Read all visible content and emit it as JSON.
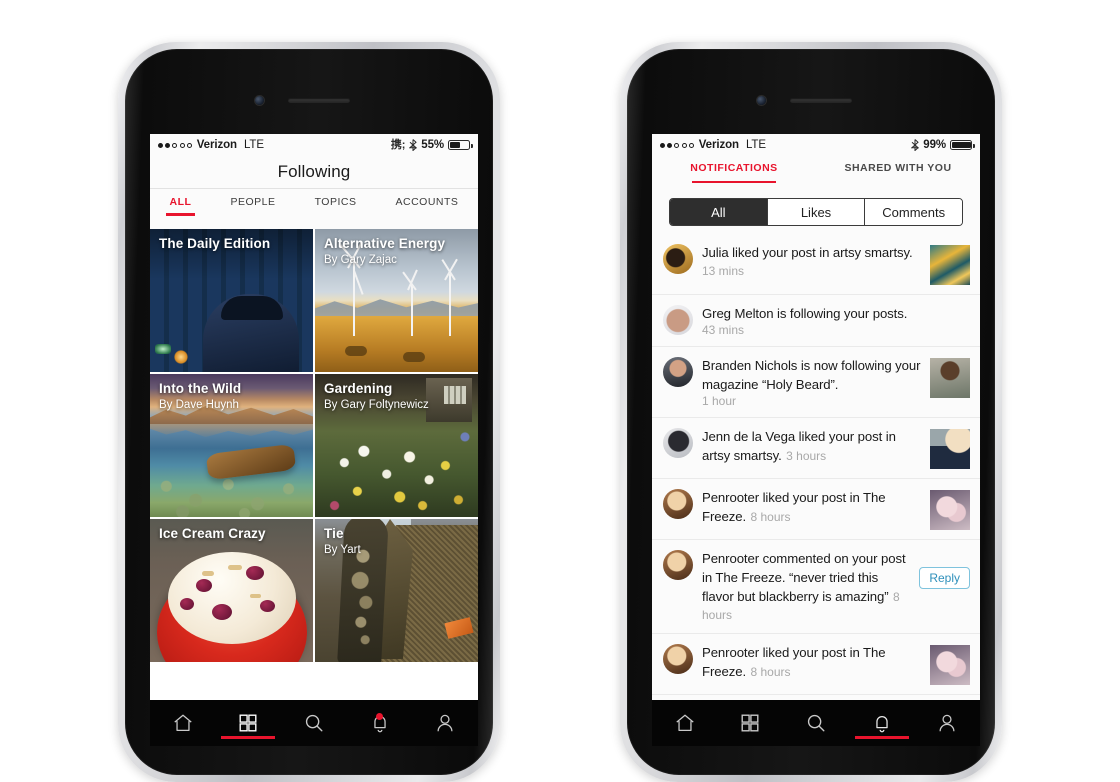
{
  "left_phone": {
    "status_bar": {
      "signal_dots": [
        true,
        true,
        false,
        false,
        false
      ],
      "carrier": "Verizon",
      "network": "LTE",
      "bluetooth_icon": "bluetooth-icon",
      "battery_percent": "55%",
      "battery_level": 55
    },
    "nav_title": "Following",
    "tabs": [
      {
        "label": "ALL",
        "active": true
      },
      {
        "label": "PEOPLE",
        "active": false
      },
      {
        "label": "TOPICS",
        "active": false
      },
      {
        "label": "ACCOUNTS",
        "active": false
      }
    ],
    "tiles": [
      {
        "title": "The Daily Edition",
        "byline": "",
        "art": "art-daily"
      },
      {
        "title": "Alternative Energy",
        "byline": "By Gary Zajac",
        "art": "art-energy"
      },
      {
        "title": "Into the Wild",
        "byline": "By Dave Huynh",
        "art": "art-wild"
      },
      {
        "title": "Gardening",
        "byline": "By Gary Foltynewicz",
        "art": "art-garden"
      },
      {
        "title": "Ice Cream Crazy",
        "byline": "",
        "art": "art-icecream"
      },
      {
        "title": "Tie",
        "byline": "By Yart",
        "art": "art-tie"
      }
    ],
    "tabbar": [
      {
        "icon": "home-icon",
        "active": false
      },
      {
        "icon": "grid-icon",
        "active": true
      },
      {
        "icon": "search-icon",
        "active": false
      },
      {
        "icon": "bell-icon",
        "active": false,
        "badge": true
      },
      {
        "icon": "person-icon",
        "active": false
      }
    ]
  },
  "right_phone": {
    "status_bar": {
      "signal_dots": [
        true,
        true,
        false,
        false,
        false
      ],
      "carrier": "Verizon",
      "network": "LTE",
      "bluetooth_icon": "bluetooth-icon",
      "battery_percent": "99%",
      "battery_level": 99
    },
    "top_tabs": [
      {
        "label": "NOTIFICATIONS",
        "active": true
      },
      {
        "label": "SHARED WITH YOU",
        "active": false
      }
    ],
    "segmented": [
      {
        "label": "All",
        "selected": true
      },
      {
        "label": "Likes",
        "selected": false
      },
      {
        "label": "Comments",
        "selected": false
      }
    ],
    "notifications": [
      {
        "text": "Julia liked your post in artsy smartsy.",
        "time": "13 mins",
        "time_inline": true,
        "avatar": "av1",
        "thumb": "th1",
        "reply": false
      },
      {
        "text": "Greg Melton is following your posts.",
        "time": "43 mins",
        "time_inline": false,
        "avatar": "av2",
        "thumb": null,
        "reply": false
      },
      {
        "text": "Branden Nichols is now following your magazine “Holy Beard”.",
        "time": "1 hour",
        "time_inline": false,
        "avatar": "av3",
        "thumb": "th2",
        "reply": false
      },
      {
        "text": "Jenn de la Vega liked your post in artsy smartsy.",
        "time": "3 hours",
        "time_inline": true,
        "avatar": "av4",
        "thumb": "th3",
        "reply": false
      },
      {
        "text": "Penrooter liked your post in The Freeze.",
        "time": "8 hours",
        "time_inline": true,
        "avatar": "av5",
        "thumb": "th4",
        "reply": false
      },
      {
        "text": "Penrooter commented on your post in The Freeze. “never tried this flavor but blackberry is amazing”",
        "time": "8 hours",
        "time_inline": true,
        "avatar": "av5",
        "thumb": null,
        "reply": true,
        "reply_label": "Reply"
      },
      {
        "text": "Penrooter liked your post in The Freeze.",
        "time": "8 hours",
        "time_inline": true,
        "avatar": "av5",
        "thumb": "th5",
        "reply": false
      }
    ],
    "tabbar": [
      {
        "icon": "home-icon",
        "active": false
      },
      {
        "icon": "grid-icon",
        "active": false
      },
      {
        "icon": "search-icon",
        "active": false
      },
      {
        "icon": "bell-icon",
        "active": true
      },
      {
        "icon": "person-icon",
        "active": false
      }
    ]
  },
  "colors": {
    "accent_red": "#e8142d",
    "tabbar_black": "#050505",
    "reply_blue": "#2f90bb",
    "reply_border": "#7fc3dd",
    "muted_text": "#a8a8a8",
    "screen_bg": "#fbfbfb"
  }
}
